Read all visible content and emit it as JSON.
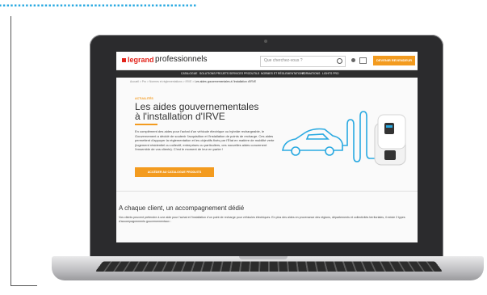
{
  "page": {
    "headline_fragment": "...................................................."
  },
  "site": {
    "brand": "legrand",
    "brand_suffix": "professionnels",
    "search_placeholder": "Que cherchez-vous ?",
    "cta_top": "DEVENIR REVENDEUR",
    "nav": [
      "CATALOGUE",
      "SOLUTIONS PROJETS",
      "SERVICES PRO",
      "OUTILS",
      "NORMES ET RÉGLEMENTATIONS",
      "FORMATIONS",
      "LIGHTS PRO"
    ],
    "breadcrumb_prefix": "Accueil  >  Pro  >  Normes et réglementations  >  IRVE  > ",
    "breadcrumb_current": "Les aides gouvernementales à l'installation d'IRVE",
    "kicker": "ACTUALITÉS",
    "title": "Les aides gouvernementales à l'installation d'IRVE",
    "body": "En complément des aides pour l'achat d'un véhicule électrique ou hybride rechargeable, le Gouvernement a décidé de soutenir l'acquisition et l'installation de points de recharge. Ces aides permettent d'appuyer la réglementation et les objectifs fixés par l'État en matière de mobilité verte (logement résidentiel ou collectif, entreprises ou particuliers, ces nouvelles aides concernent l'ensemble de vos clients). C'est le moment de leur en parler !",
    "cta_main": "ACCÉDER AU CATALOGUE PRODUITS",
    "section_title": "A chaque client, un accompagnement dédié",
    "section_text": "Vos clients peuvent prétendre à une aide pour l'achat et l'installation d'un point de recharge pour véhicules électriques. En plus des aides en provenance des régions, départements et collectivités territoriales, il existe 2 types d'accompagnements gouvernementaux :"
  },
  "colors": {
    "accent_orange": "#f39b1f",
    "brand_red": "#e2231a",
    "illustration_blue": "#29a9e1",
    "nav_dark": "#2d2d2d"
  }
}
